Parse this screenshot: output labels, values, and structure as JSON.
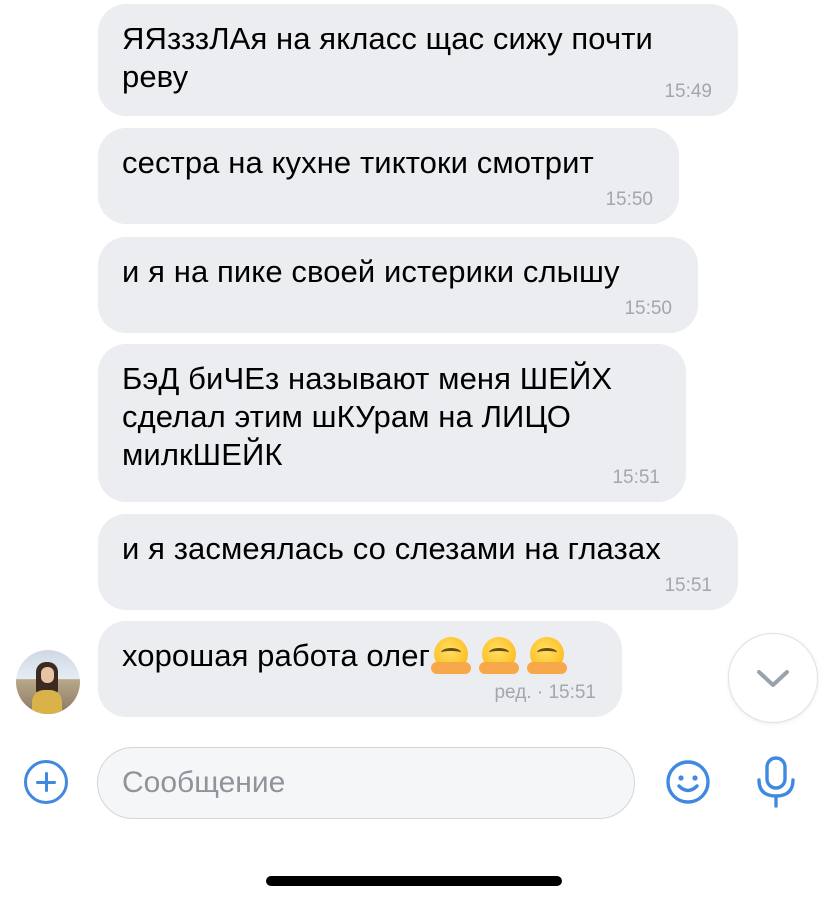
{
  "messages": [
    {
      "text": "ЯЯзззЛАя на якласс щас сижу почти\nреву",
      "time": "15:49"
    },
    {
      "text": "сестра на кухне тиктоки смотрит",
      "time": "15:50"
    },
    {
      "text": "и я на пике своей истерики слышу",
      "time": "15:50"
    },
    {
      "text": "БэД биЧЕз называют меня ШЕЙХ\nсделал этим шКУрам на ЛИЦО\nмилкШЕЙК",
      "time": "15:51"
    },
    {
      "text": "и я засмеялась со слезами на глазах",
      "time": "15:51"
    },
    {
      "text": "хорошая работа олег",
      "emoji": "🤗🤗🤗",
      "time": "ред. · 15:51"
    }
  ],
  "composer": {
    "placeholder": "Сообщение",
    "value": ""
  },
  "icons": {
    "attach": "plus-circle-icon",
    "emoji": "smile-icon",
    "voice": "microphone-icon",
    "scroll": "chevron-down-icon"
  },
  "colors": {
    "accent": "#3f8ae0",
    "bubble_bg": "#ebedf0",
    "timestamp": "#a3a7ad",
    "placeholder": "#8f949b"
  }
}
